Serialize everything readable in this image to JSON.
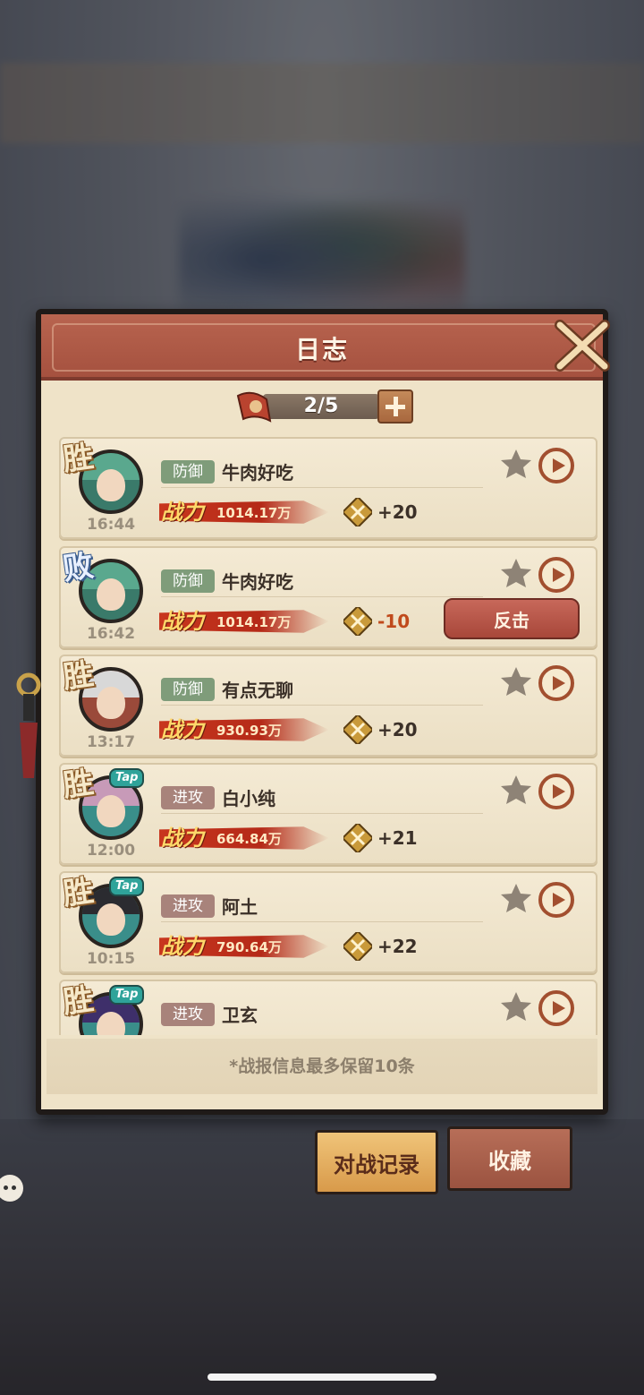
{
  "dialog": {
    "title": "日志",
    "counter": "2/5",
    "note": "*战报信息最多保留10条"
  },
  "labels": {
    "power": "战力",
    "counterattack": "反击",
    "tap": "Tap"
  },
  "entries": [
    {
      "result": "胜",
      "time": "16:44",
      "mode": "防御",
      "name": "牛肉好吃",
      "power": "1014.17万",
      "delta": "+20",
      "tap": false,
      "counter": false
    },
    {
      "result": "败",
      "time": "16:42",
      "mode": "防御",
      "name": "牛肉好吃",
      "power": "1014.17万",
      "delta": "-10",
      "tap": false,
      "counter": true
    },
    {
      "result": "胜",
      "time": "13:17",
      "mode": "防御",
      "name": "有点无聊",
      "power": "930.93万",
      "delta": "+20",
      "tap": false,
      "counter": false
    },
    {
      "result": "胜",
      "time": "12:00",
      "mode": "进攻",
      "name": "白小纯",
      "power": "664.84万",
      "delta": "+21",
      "tap": true,
      "counter": false
    },
    {
      "result": "胜",
      "time": "10:15",
      "mode": "进攻",
      "name": "阿土",
      "power": "790.64万",
      "delta": "+22",
      "tap": true,
      "counter": false
    },
    {
      "result": "胜",
      "time": "",
      "mode": "进攻",
      "name": "卫玄",
      "power": "",
      "delta": "",
      "tap": true,
      "counter": false
    }
  ],
  "tabs": {
    "record": "对战记录",
    "favorite": "收藏"
  },
  "colors": {
    "header": "#a5513f",
    "panel": "#efe3c8",
    "defense_tag": "#7f9c7a",
    "attack_tag": "#a8837b",
    "negative": "#c04a1c"
  }
}
